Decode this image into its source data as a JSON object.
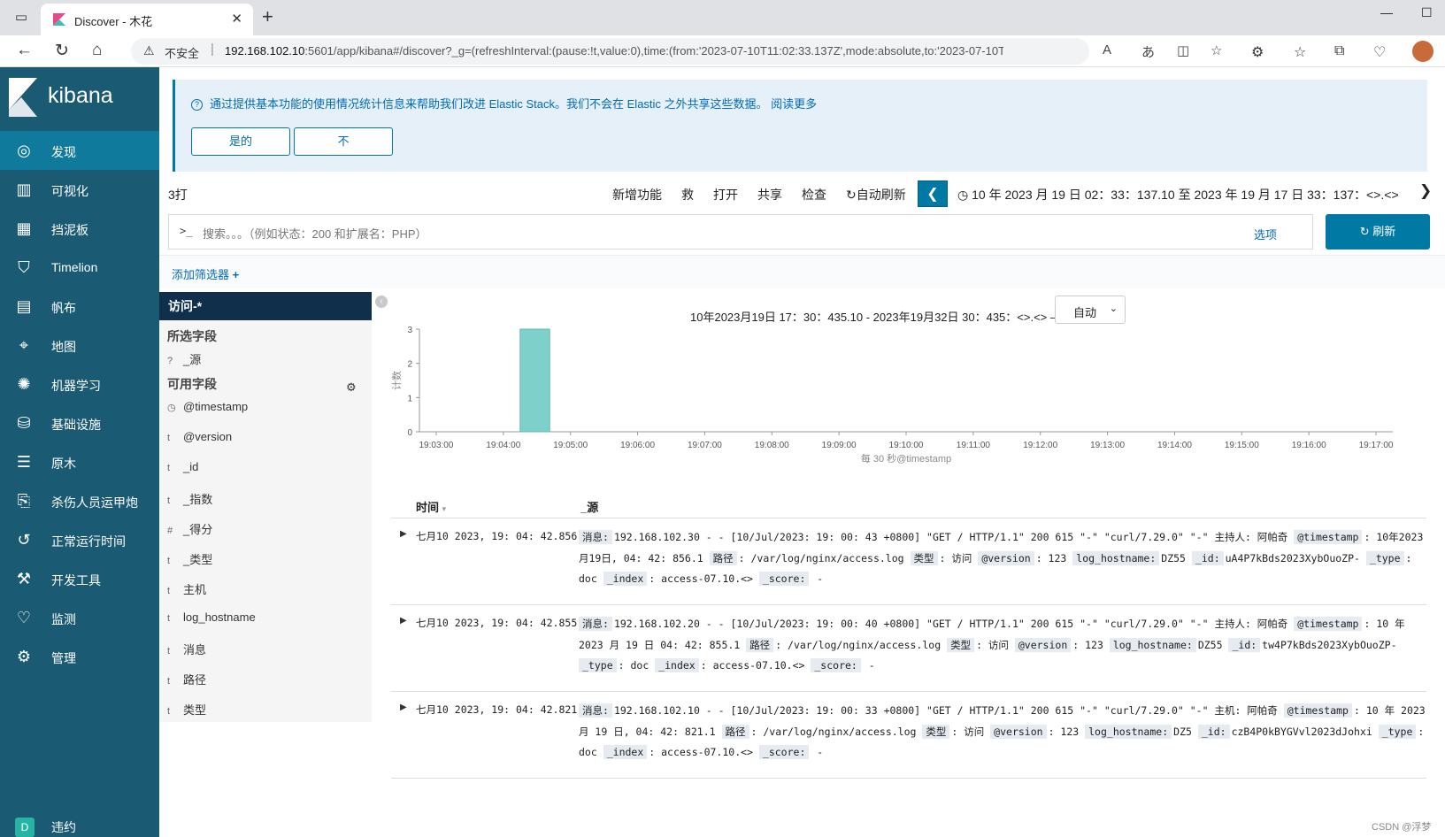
{
  "browser": {
    "tab_title": "Discover - 木花",
    "insecure_label": "不安全",
    "url_host": "192.168.102.10",
    "url_rest": ":5601/app/kibana#/discover?_g=(refreshInterval:(pause:!t,value:0),time:(from:'2023-07-10T11:02:33.137Z',mode:absolute,to:'2023-07-10T11:17:..."
  },
  "sidebar": {
    "logo": "kibana",
    "items": [
      {
        "label": "发现",
        "icon": "compass-icon"
      },
      {
        "label": "可视化",
        "icon": "visualize-icon"
      },
      {
        "label": "挡泥板",
        "icon": "dashboard-icon"
      },
      {
        "label": "Timelion",
        "icon": "timelion-icon"
      },
      {
        "label": "帆布",
        "icon": "canvas-icon"
      },
      {
        "label": "地图",
        "icon": "maps-icon"
      },
      {
        "label": "机器学习",
        "icon": "ml-icon"
      },
      {
        "label": "基础设施",
        "icon": "infra-icon"
      },
      {
        "label": "原木",
        "icon": "logs-icon"
      },
      {
        "label": "杀伤人员运甲炮",
        "icon": "apm-icon"
      },
      {
        "label": "正常运行时间",
        "icon": "uptime-icon"
      },
      {
        "label": "开发工具",
        "icon": "devtools-icon"
      },
      {
        "label": "监测",
        "icon": "monitoring-icon"
      },
      {
        "label": "管理",
        "icon": "gear-icon"
      }
    ],
    "dock_avatar": "D",
    "dock_label": "违约"
  },
  "callout": {
    "text": "通过提供基本功能的使用情况统计信息来帮助我们改进 Elastic Stack。我们不会在 Elastic 之外共享这些数据。 阅读更多",
    "yes": "是的",
    "no": "不"
  },
  "topnav": {
    "hits": "3打",
    "links": [
      "新增功能",
      "救",
      "打开",
      "共享",
      "检查",
      "自动刷新"
    ],
    "time_range": "10 年 2023 月 19 日 02：33：137.10 至 2023 年 19 月 17 日 33：137：<>.<>"
  },
  "query": {
    "prompt": ">_",
    "placeholder": "搜索。。。（例如状态：200 和扩展名：PHP）",
    "options": "选项",
    "refresh": "刷新"
  },
  "filter": {
    "add": "添加筛选器"
  },
  "fields": {
    "index_pattern": "访问-*",
    "selected_title": "所选字段",
    "selected": [
      {
        "type": "?",
        "name": "_源"
      }
    ],
    "available_title": "可用字段",
    "available": [
      {
        "type": "◷",
        "name": "@timestamp"
      },
      {
        "type": "t",
        "name": "@version"
      },
      {
        "type": "t",
        "name": "_id"
      },
      {
        "type": "t",
        "name": "_指数"
      },
      {
        "type": "#",
        "name": "_得分"
      },
      {
        "type": "t",
        "name": "_类型"
      },
      {
        "type": "t",
        "name": "主机"
      },
      {
        "type": "t",
        "name": "log_hostname"
      },
      {
        "type": "t",
        "name": "消息"
      },
      {
        "type": "t",
        "name": "路径"
      },
      {
        "type": "t",
        "name": "类型"
      }
    ]
  },
  "histogram": {
    "header": "10年2023月19日 17：30：435.10 - 2023年19月32日 30：435：<>.<> —",
    "interval": "自动"
  },
  "chart_data": {
    "type": "bar",
    "categories": [
      "19:03:00",
      "19:03:30",
      "19:04:00",
      "19:04:30",
      "19:05:00",
      "19:05:30",
      "19:06:00",
      "19:06:30",
      "19:07:00",
      "19:07:30",
      "19:08:00",
      "19:08:30",
      "19:09:00",
      "19:09:30",
      "19:10:00",
      "19:10:30",
      "19:11:00",
      "19:11:30",
      "19:12:00",
      "19:12:30",
      "19:13:00",
      "19:13:30",
      "19:14:00",
      "19:14:30",
      "19:15:00",
      "19:15:30",
      "19:16:00",
      "19:16:30",
      "19:17:00"
    ],
    "values": [
      0,
      0,
      0,
      3,
      0,
      0,
      0,
      0,
      0,
      0,
      0,
      0,
      0,
      0,
      0,
      0,
      0,
      0,
      0,
      0,
      0,
      0,
      0,
      0,
      0,
      0,
      0,
      0,
      0
    ],
    "x_tick_labels": [
      "19:03:00",
      "19:04:00",
      "19:05:00",
      "19:06:00",
      "19:07:00",
      "19:08:00",
      "19:09:00",
      "19:10:00",
      "19:11:00",
      "19:12:00",
      "19:13:00",
      "19:14:00",
      "19:15:00",
      "19:16:00",
      "19:17:00"
    ],
    "y_ticks": [
      0,
      1,
      2,
      3
    ],
    "ylim": [
      0,
      3
    ],
    "xlabel": "每 30 秒@timestamp",
    "ylabel": "计数",
    "color": "#7ed1cb",
    "grid": false
  },
  "documents": {
    "col_time": "时间",
    "col_source": "_源",
    "rows": [
      {
        "time": "七月10 2023, 19: 04: 42.856",
        "source": [
          {
            "k": "消息:",
            "v": "192.168.102.30 - - [10/Jul/2023: 19: 00: 43 +0800] \"GET / HTTP/1.1\" 200 615 \"-\" \"curl/7.29.0\" \"-\" 主持人: 阿帕奇"
          },
          {
            "k": "@timestamp",
            "v": ": 10年2023月19日, 04: 42: 856.1"
          },
          {
            "k": "路径",
            "v": ": /var/log/nginx/access.log"
          },
          {
            "k": "类型",
            "v": ": 访问"
          },
          {
            "k": "@version",
            "v": ": 123"
          },
          {
            "k": "log_hostname:",
            "v": "DZ55"
          },
          {
            "k": "_id:",
            "v": "uA4P7kBds2023XybOuoZP-"
          },
          {
            "k": "_type",
            "v": ": doc"
          },
          {
            "k": "_index",
            "v": ": access-07.10.<>"
          },
          {
            "k": "_score:",
            "v": " -"
          }
        ]
      },
      {
        "time": "七月10 2023, 19: 04: 42.855",
        "source": [
          {
            "k": "消息:",
            "v": "192.168.102.20 - - [10/Jul/2023: 19: 00: 40 +0800] \"GET / HTTP/1.1\" 200 615 \"-\" \"curl/7.29.0\" \"-\" 主持人: 阿帕奇"
          },
          {
            "k": "@timestamp",
            "v": ": 10 年 2023 月 19 日 04: 42: 855.1"
          },
          {
            "k": "路径",
            "v": ": /var/log/nginx/access.log"
          },
          {
            "k": "类型",
            "v": ": 访问"
          },
          {
            "k": "@version",
            "v": ": 123"
          },
          {
            "k": "log_hostname:",
            "v": "DZ55"
          },
          {
            "k": "_id:",
            "v": "tw4P7kBds2023XybOuoZP-"
          },
          {
            "k": "_type",
            "v": ": doc"
          },
          {
            "k": "_index",
            "v": ": access-07.10.<>"
          },
          {
            "k": "_score:",
            "v": " -"
          }
        ]
      },
      {
        "time": "七月10 2023, 19: 04: 42.821",
        "source": [
          {
            "k": "消息:",
            "v": "192.168.102.10 - - [10/Jul/2023: 19: 00: 33 +0800] \"GET / HTTP/1.1\" 200 615 \"-\" \"curl/7.29.0\" \"-\" 主机: 阿帕奇"
          },
          {
            "k": "@timestamp",
            "v": ": 10 年 2023 月 19 日, 04: 42: 821.1"
          },
          {
            "k": "路径",
            "v": ": /var/log/nginx/access.log"
          },
          {
            "k": "类型",
            "v": ": 访问"
          },
          {
            "k": "@version",
            "v": ": 123"
          },
          {
            "k": "log_hostname:",
            "v": "DZ5"
          },
          {
            "k": "_id:",
            "v": "czB4P0kBYGVvl2023dJohxi"
          },
          {
            "k": "_type",
            "v": ": doc"
          },
          {
            "k": "_index",
            "v": ": access-07.10.<>"
          },
          {
            "k": "_score:",
            "v": " -"
          }
        ]
      }
    ]
  },
  "watermark": "CSDN @浮梦"
}
